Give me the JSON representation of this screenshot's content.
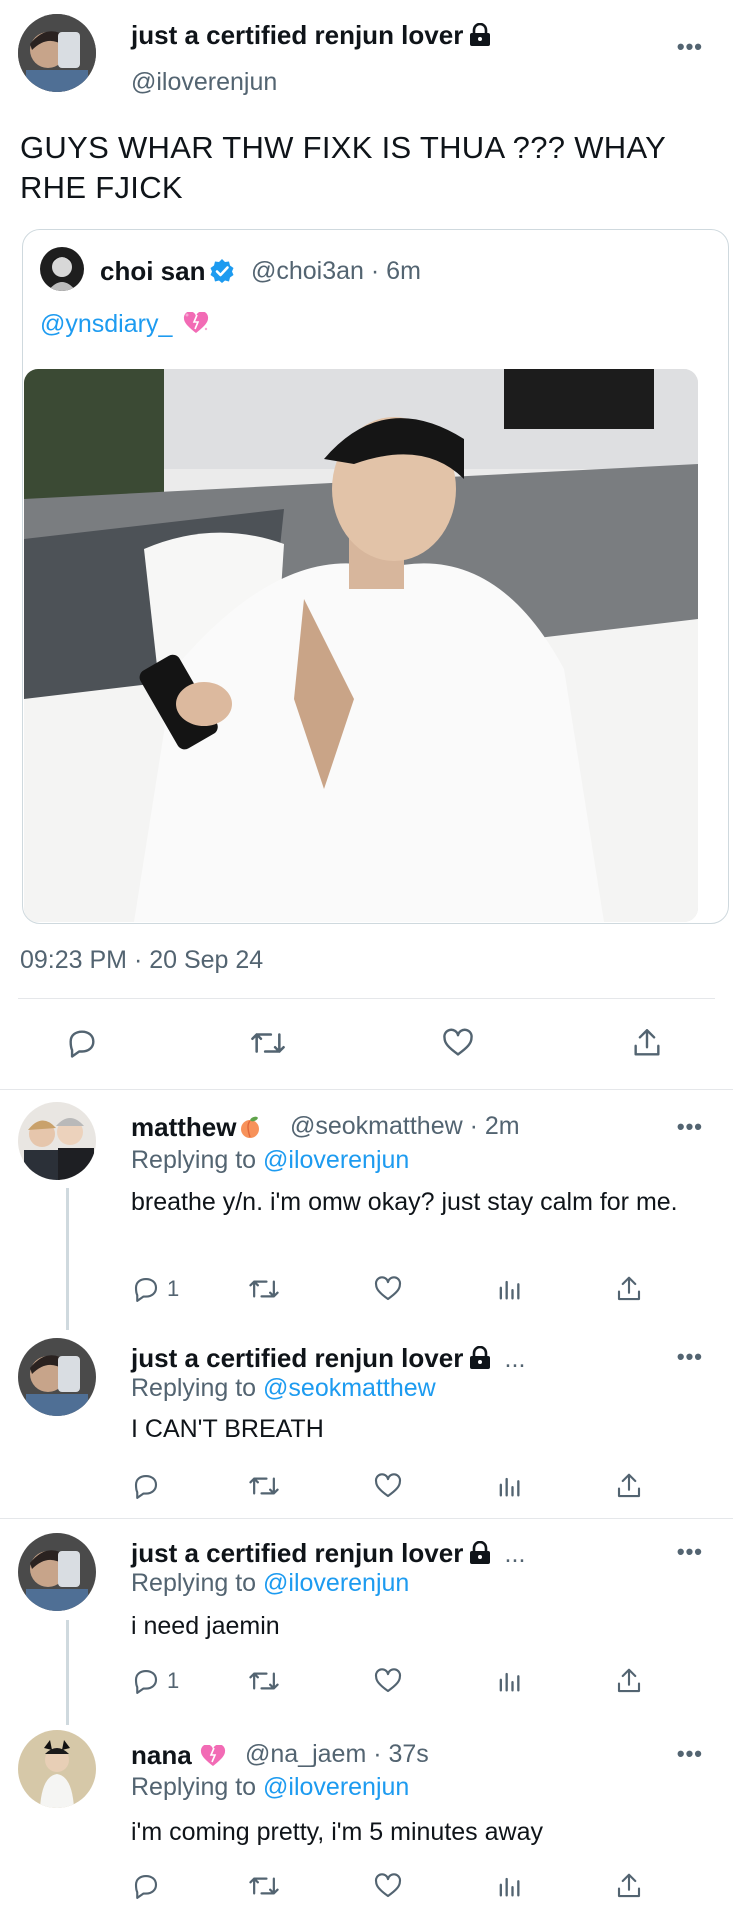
{
  "main_tweet": {
    "display_name": "just a certified renjun lover",
    "handle": "@iloverenjun",
    "text": "GUYS WHAR THW FIXK IS THUA ??? WHAY RHE FJICK",
    "timestamp": "09:23 PM · 20 Sep 24"
  },
  "quoted_tweet": {
    "display_name": "choi san",
    "handle_time": "@choi3an · 6m",
    "mention": "@ynsdiary_"
  },
  "replies": [
    {
      "display_name": "matthew",
      "handle_time": "@seokmatthew · 2m",
      "replying_label": "Replying to",
      "replying_to": "@iloverenjun",
      "text": "breathe y/n. i'm omw okay? just stay calm for me.",
      "reply_count": "1"
    },
    {
      "display_name": "just a certified renjun lover",
      "ellipsis": "...",
      "replying_label": "Replying to",
      "replying_to": "@seokmatthew",
      "text": "I CAN'T BREATH",
      "reply_count": ""
    },
    {
      "display_name": "just a certified renjun lover",
      "ellipsis": "...",
      "replying_label": "Replying to",
      "replying_to": "@iloverenjun",
      "text": "i need jaemin",
      "reply_count": "1"
    },
    {
      "display_name": "nana",
      "handle_time": "@na_jaem · 37s",
      "replying_label": "Replying to",
      "replying_to": "@iloverenjun",
      "text": "i'm coming pretty, i'm 5 minutes away",
      "reply_count": ""
    }
  ],
  "more_label": "•••",
  "colors": {
    "accent": "#1d9bf0",
    "muted": "#536471",
    "verified": "#1d9bf0"
  },
  "icons": [
    "lock-icon",
    "verified-badge-icon",
    "reply-icon",
    "retweet-icon",
    "like-icon",
    "views-icon",
    "share-icon",
    "more-icon"
  ]
}
